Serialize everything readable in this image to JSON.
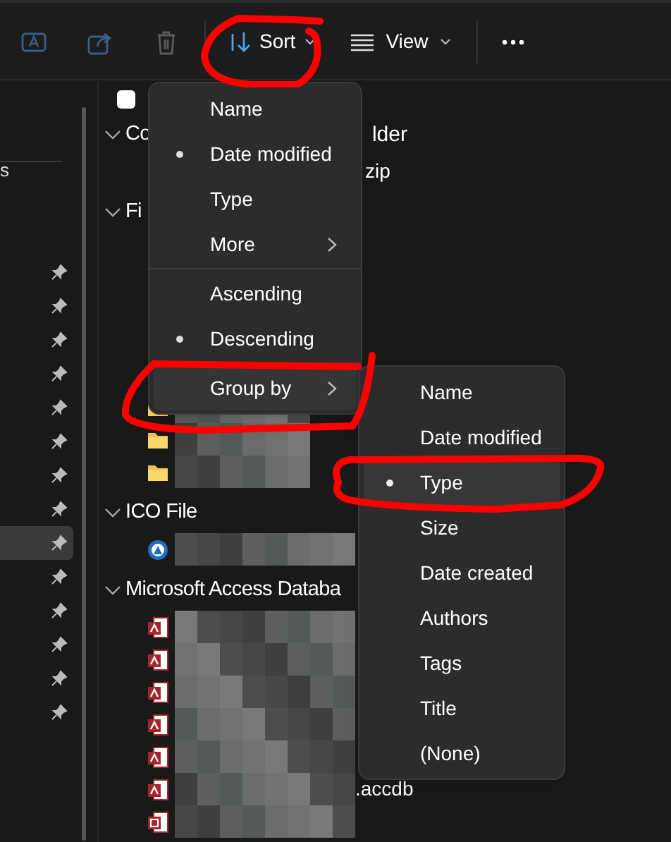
{
  "toolbar": {
    "sort": "Sort",
    "view": "View"
  },
  "sidebar": {
    "cut_label": "s",
    "pinned_items": [
      {
        "selected": false
      },
      {
        "selected": false
      },
      {
        "selected": false
      },
      {
        "selected": false
      },
      {
        "selected": false
      },
      {
        "selected": false
      },
      {
        "selected": false
      },
      {
        "selected": false
      },
      {
        "selected": true
      },
      {
        "selected": false
      },
      {
        "selected": false
      },
      {
        "selected": false
      },
      {
        "selected": false
      },
      {
        "selected": false
      }
    ]
  },
  "groups": [
    {
      "header": "Co",
      "header_tail": "lder",
      "files": [
        {
          "kind": "none",
          "suffix": "zip"
        }
      ]
    },
    {
      "header": "Fi",
      "files": [
        {
          "kind": "folder"
        },
        {
          "kind": "folder"
        },
        {
          "kind": "folder"
        }
      ]
    },
    {
      "header": "ICO File",
      "files": [
        {
          "kind": "ico"
        }
      ]
    },
    {
      "header": "Microsoft Access Databa",
      "files": [
        {
          "kind": "access"
        },
        {
          "kind": "access"
        },
        {
          "kind": "access"
        },
        {
          "kind": "access"
        },
        {
          "kind": "access"
        },
        {
          "kind": "access",
          "suffix": ".accdb"
        },
        {
          "kind": "publisher"
        }
      ]
    }
  ],
  "sort_menu": {
    "sections": [
      [
        {
          "label": "Name",
          "selected": false,
          "kind": "item"
        },
        {
          "label": "Date modified",
          "selected": true,
          "kind": "item"
        },
        {
          "label": "Type",
          "selected": false,
          "kind": "item"
        },
        {
          "label": "More",
          "selected": false,
          "kind": "submenu"
        }
      ],
      [
        {
          "label": "Ascending",
          "selected": false,
          "kind": "item"
        },
        {
          "label": "Descending",
          "selected": true,
          "kind": "item"
        }
      ],
      [
        {
          "label": "Group by",
          "selected": false,
          "kind": "submenu"
        }
      ]
    ]
  },
  "group_by_menu": {
    "items": [
      {
        "label": "Name",
        "selected": false
      },
      {
        "label": "Date modified",
        "selected": false
      },
      {
        "label": "Type",
        "selected": true
      },
      {
        "label": "Size",
        "selected": false
      },
      {
        "label": "Date created",
        "selected": false
      },
      {
        "label": "Authors",
        "selected": false
      },
      {
        "label": "Tags",
        "selected": false
      },
      {
        "label": "Title",
        "selected": false
      },
      {
        "label": "(None)",
        "selected": false
      }
    ]
  },
  "select_all": {
    "checked": false
  },
  "annotations": [
    {
      "kind": "loop"
    },
    {
      "kind": "loop"
    },
    {
      "kind": "loop"
    }
  ]
}
